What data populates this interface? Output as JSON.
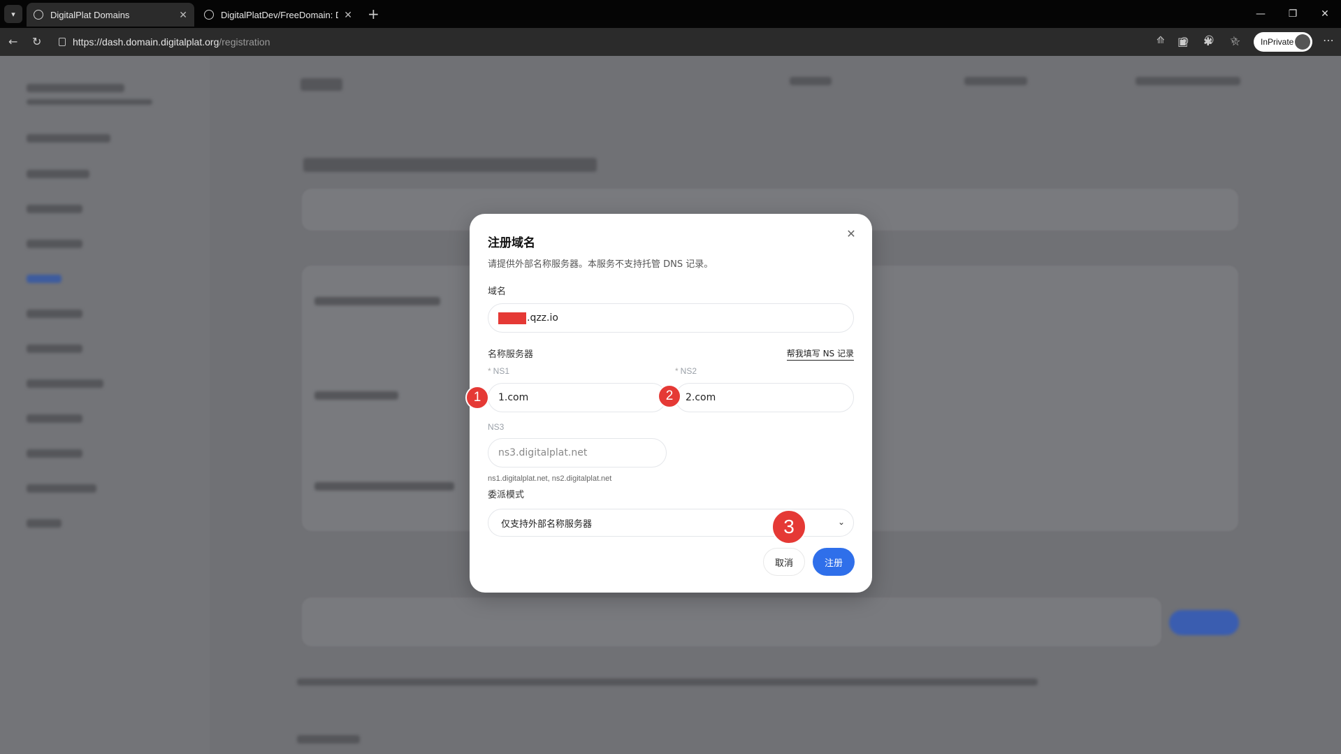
{
  "browser": {
    "tabs": [
      {
        "title": "DigitalPlat Domains",
        "active": true
      },
      {
        "title": "DigitalPlatDev/FreeDomain: Digit",
        "active": false
      }
    ],
    "url_main": "https://dash.domain.digitalplat.org",
    "url_rest": "/registration",
    "profile_label": "InPrivate"
  },
  "modal": {
    "title": "注册域名",
    "description": "请提供外部名称服务器。本服务不支持托管 DNS 记录。",
    "domain_label": "域名",
    "domain_suffix": ".qzz.io",
    "nameserver_label": "名称服务器",
    "help_link": "帮我填写 NS 记录",
    "ns1_label": "NS1",
    "ns1_value": "1.com",
    "ns2_label": "NS2",
    "ns2_value": "2.com",
    "ns3_label": "NS3",
    "ns3_value": "ns3.digitalplat.net",
    "ns_hint": "ns1.digitalplat.net, ns2.digitalplat.net",
    "delegation_label": "委派模式",
    "delegation_value": "仅支持外部名称服务器",
    "cancel_label": "取消",
    "submit_label": "注册"
  },
  "markers": [
    "1",
    "2",
    "3"
  ],
  "colors": {
    "accent": "#2f6fea",
    "marker": "#e53935"
  }
}
